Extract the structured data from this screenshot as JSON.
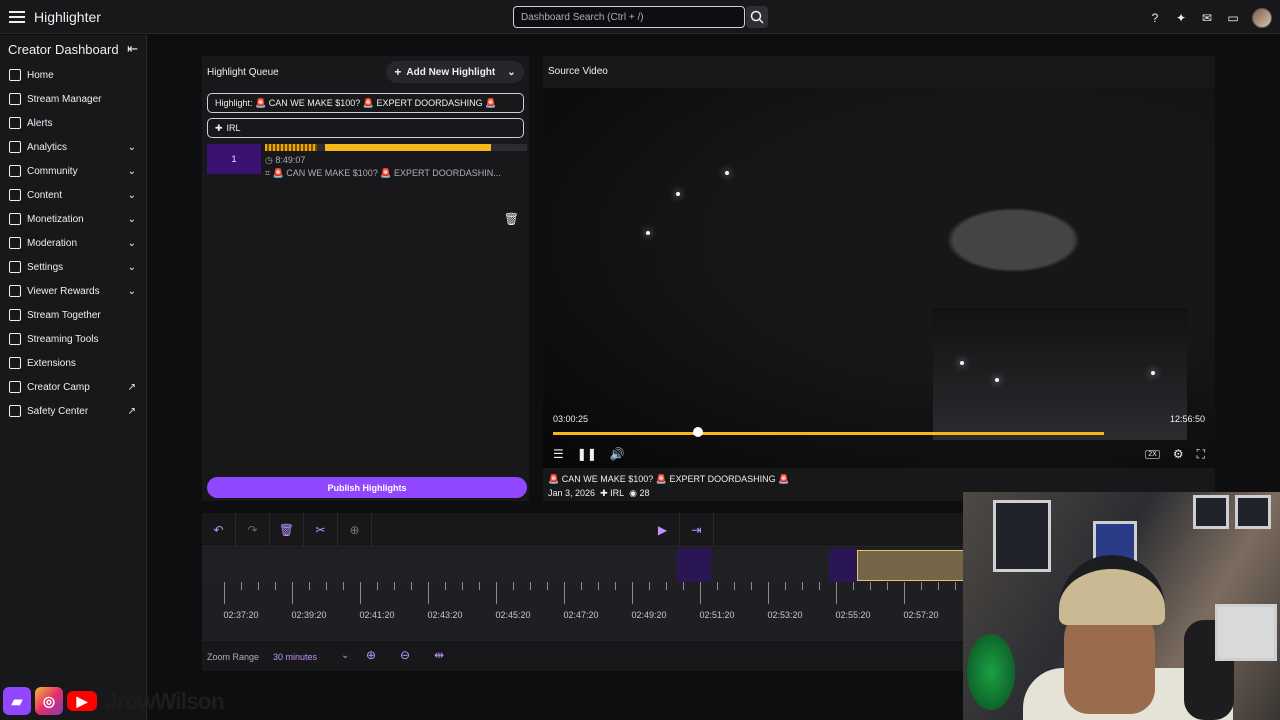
{
  "header": {
    "app_title": "Highlighter",
    "search_placeholder": "Dashboard Search (Ctrl + /)",
    "icons": [
      "help-icon",
      "sparkle-icon",
      "inbox-icon",
      "chat-icon",
      "user-avatar"
    ]
  },
  "sidebar": {
    "title": "Creator Dashboard",
    "items": [
      {
        "label": "Home",
        "icon": "home-icon"
      },
      {
        "label": "Stream Manager",
        "icon": "stream-manager-icon"
      },
      {
        "label": "Alerts",
        "icon": "alerts-icon"
      },
      {
        "label": "Analytics",
        "icon": "analytics-icon",
        "expandable": true
      },
      {
        "label": "Community",
        "icon": "community-icon",
        "expandable": true
      },
      {
        "label": "Content",
        "icon": "content-icon",
        "expandable": true
      },
      {
        "label": "Monetization",
        "icon": "monetization-icon",
        "expandable": true
      },
      {
        "label": "Moderation",
        "icon": "moderation-icon",
        "expandable": true
      },
      {
        "label": "Settings",
        "icon": "settings-icon",
        "expandable": true
      },
      {
        "label": "Viewer Rewards",
        "icon": "viewer-rewards-icon",
        "expandable": true
      },
      {
        "label": "Stream Together",
        "icon": "stream-together-icon"
      },
      {
        "label": "Streaming Tools",
        "icon": "streaming-tools-icon"
      },
      {
        "label": "Extensions",
        "icon": "extensions-icon"
      },
      {
        "label": "Creator Camp",
        "icon": "creator-camp-icon",
        "external": true
      },
      {
        "label": "Safety Center",
        "icon": "safety-center-icon",
        "external": true
      }
    ]
  },
  "queue": {
    "title": "Highlight Queue",
    "add_label": "Add New Highlight",
    "highlight_field": "Highlight: 🚨 CAN WE MAKE $100? 🚨 EXPERT DOORDASHING 🚨",
    "category_field": "IRL",
    "clip": {
      "number": "1",
      "duration": "8:49:07",
      "title": "🚨 CAN WE MAKE $100? 🚨 EXPERT DOORDASHIN..."
    },
    "publish_label": "Publish Highlights"
  },
  "source": {
    "title": "Source Video",
    "current_time": "03:00:25",
    "duration": "12:56:50",
    "speed": "2X",
    "stream_title": "🚨 CAN WE MAKE $100? 🚨 EXPERT DOORDASHING 🚨",
    "date": "Jan 3, 2026",
    "category": "IRL",
    "views": "28"
  },
  "timeline": {
    "ticks": [
      "02:37:20",
      "02:39:20",
      "02:41:20",
      "02:43:20",
      "02:45:20",
      "02:47:20",
      "02:49:20",
      "02:51:20",
      "02:53:20",
      "02:55:20",
      "02:57:20"
    ],
    "zoom_label": "Zoom Range",
    "zoom_value": "30 minutes"
  }
}
